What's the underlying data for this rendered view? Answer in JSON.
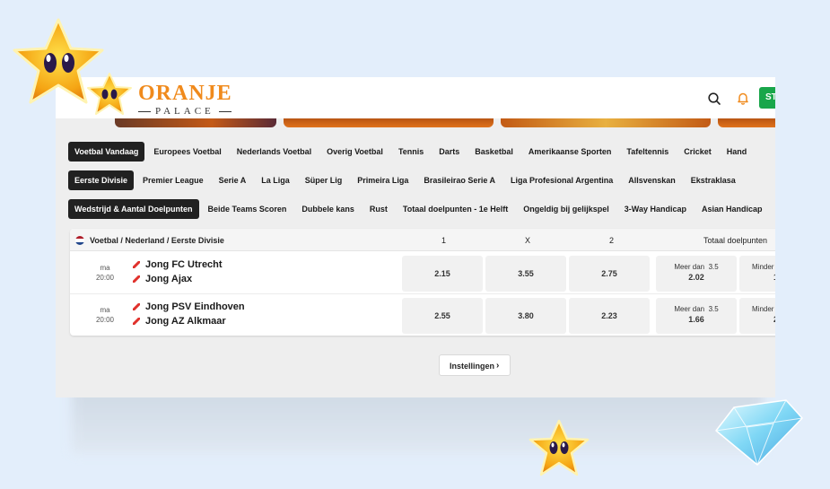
{
  "header": {
    "logo_main": "ORANJE",
    "logo_sub": "PALACE",
    "start_button_label": "ST"
  },
  "tabs_sports": [
    {
      "label": "Voetbal Vandaag",
      "active": true
    },
    {
      "label": "Europees Voetbal",
      "active": false
    },
    {
      "label": "Nederlands Voetbal",
      "active": false
    },
    {
      "label": "Overig Voetbal",
      "active": false
    },
    {
      "label": "Tennis",
      "active": false
    },
    {
      "label": "Darts",
      "active": false
    },
    {
      "label": "Basketbal",
      "active": false
    },
    {
      "label": "Amerikaanse Sporten",
      "active": false
    },
    {
      "label": "Tafeltennis",
      "active": false
    },
    {
      "label": "Cricket",
      "active": false
    },
    {
      "label": "Hand",
      "active": false
    }
  ],
  "tabs_leagues": [
    {
      "label": "Eerste Divisie",
      "active": true
    },
    {
      "label": "Premier League",
      "active": false
    },
    {
      "label": "Serie A",
      "active": false
    },
    {
      "label": "La Liga",
      "active": false
    },
    {
      "label": "Süper Lig",
      "active": false
    },
    {
      "label": "Primeira Liga",
      "active": false
    },
    {
      "label": "Brasileirao Serie A",
      "active": false
    },
    {
      "label": "Liga Profesional Argentina",
      "active": false
    },
    {
      "label": "Allsvenskan",
      "active": false
    },
    {
      "label": "Ekstraklasa",
      "active": false
    }
  ],
  "tabs_markets": [
    {
      "label": "Wedstrijd & Aantal Doelpunten",
      "active": true
    },
    {
      "label": "Beide Teams Scoren",
      "active": false
    },
    {
      "label": "Dubbele kans",
      "active": false
    },
    {
      "label": "Rust",
      "active": false
    },
    {
      "label": "Totaal doelpunten - 1e Helft",
      "active": false
    },
    {
      "label": "Ongeldig bij gelijkspel",
      "active": false
    },
    {
      "label": "3-Way Handicap",
      "active": false
    },
    {
      "label": "Asian Handicap",
      "active": false
    }
  ],
  "panel": {
    "league_path": "Voetbal / Nederland / Eerste Divisie",
    "col_1": "1",
    "col_x": "X",
    "col_2": "2",
    "col_total": "Totaal doelpunten"
  },
  "matches": [
    {
      "day": "ma",
      "time": "20:00",
      "home": "Jong FC Utrecht",
      "away": "Jong Ajax",
      "odds_1": "2.15",
      "odds_x": "3.55",
      "odds_2": "2.75",
      "over_label": "Meer dan",
      "over_line": "3.5",
      "over_odds": "2.02",
      "under_label": "Minder",
      "under_odds": "1"
    },
    {
      "day": "ma",
      "time": "20:00",
      "home": "Jong PSV Eindhoven",
      "away": "Jong AZ Alkmaar",
      "odds_1": "2.55",
      "odds_x": "3.80",
      "odds_2": "2.23",
      "over_label": "Meer dan",
      "over_line": "3.5",
      "over_odds": "1.66",
      "under_label": "Minder",
      "under_odds": "2"
    }
  ],
  "settings_label": "Instellingen",
  "colors": {
    "brand_orange": "#f08a1c",
    "active_tab": "#212121",
    "start_green": "#19a64a",
    "background": "#e3eefb"
  },
  "icons": [
    "search-icon",
    "bell-icon",
    "chevron-right-icon",
    "netherlands-flag-icon",
    "shirt-icon",
    "star-mascot-icon",
    "diamond-icon"
  ]
}
